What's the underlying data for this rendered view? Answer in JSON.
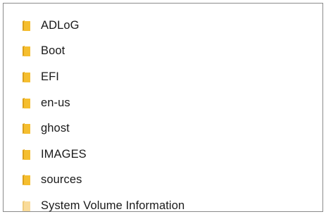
{
  "folders": [
    {
      "name": "ADLoG",
      "hidden": false
    },
    {
      "name": "Boot",
      "hidden": false
    },
    {
      "name": "EFI",
      "hidden": false
    },
    {
      "name": "en-us",
      "hidden": false
    },
    {
      "name": "ghost",
      "hidden": false
    },
    {
      "name": "IMAGES",
      "hidden": false
    },
    {
      "name": "sources",
      "hidden": false
    },
    {
      "name": "System Volume Information",
      "hidden": true
    }
  ],
  "icon": "folder-icon",
  "colors": {
    "folder_front": "#F5BE2F",
    "folder_back": "#DCA019",
    "folder_hidden_front": "#F9DB9A",
    "folder_hidden_back": "#EFCB7C",
    "text": "#1A1A1A",
    "border": "#8A8A8A"
  }
}
